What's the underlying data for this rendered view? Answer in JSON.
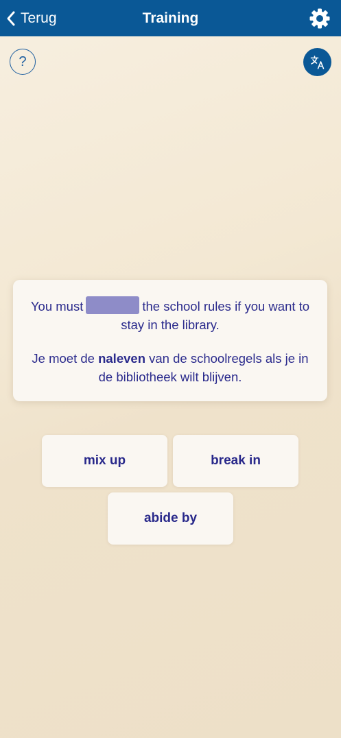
{
  "header": {
    "back_label": "Terug",
    "title": "Training"
  },
  "help": {
    "label": "?"
  },
  "exercise": {
    "en_before": "You must",
    "en_after": "the school rules if you want to stay in the library.",
    "nl_before": "Je moet de",
    "nl_bold": "naleven",
    "nl_after": "van de schoolregels als je in de bibliotheek wilt blijven."
  },
  "answers": [
    {
      "label": "mix up"
    },
    {
      "label": "break in"
    },
    {
      "label": "abide by"
    }
  ],
  "colors": {
    "header_bg": "#0a5896",
    "text": "#2a2a8c",
    "blank": "#8e8cc8",
    "card_bg": "#faf7f2"
  },
  "icons": {
    "back": "chevron-left-icon",
    "settings": "gear-icon",
    "help": "question-icon",
    "translate": "translate-icon"
  }
}
